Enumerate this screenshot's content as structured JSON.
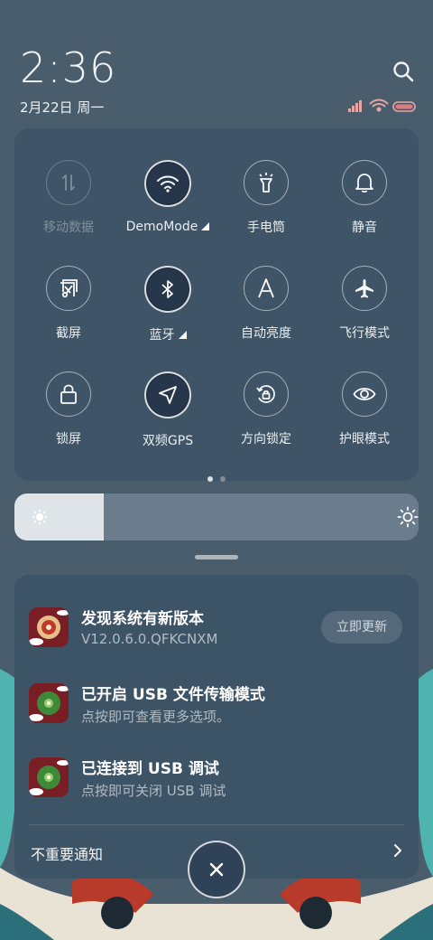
{
  "status_bar": {
    "time": "2:36",
    "date": "2月22日 周一"
  },
  "quick_settings": {
    "tiles": [
      {
        "label": "移动数据",
        "icon": "mobile-data-icon",
        "state": "disabled"
      },
      {
        "label": "DemoMode",
        "icon": "wifi-icon",
        "state": "active",
        "expandable": true
      },
      {
        "label": "手电筒",
        "icon": "flashlight-icon",
        "state": "off"
      },
      {
        "label": "静音",
        "icon": "bell-icon",
        "state": "off"
      },
      {
        "label": "截屏",
        "icon": "screenshot-icon",
        "state": "off"
      },
      {
        "label": "蓝牙",
        "icon": "bluetooth-icon",
        "state": "active",
        "expandable": true
      },
      {
        "label": "自动亮度",
        "icon": "auto-brightness-icon",
        "state": "off"
      },
      {
        "label": "飞行模式",
        "icon": "airplane-icon",
        "state": "off"
      },
      {
        "label": "锁屏",
        "icon": "lock-icon",
        "state": "off"
      },
      {
        "label": "双频GPS",
        "icon": "gps-icon",
        "state": "active"
      },
      {
        "label": "方向锁定",
        "icon": "rotation-lock-icon",
        "state": "off"
      },
      {
        "label": "护眼模式",
        "icon": "eye-icon",
        "state": "off"
      }
    ],
    "page_count": 2,
    "current_page": 1
  },
  "brightness": {
    "level": 0.22
  },
  "notifications": [
    {
      "title": "发现系统有新版本",
      "subtitle": "V12.0.6.0.QFKCNXM",
      "action": "立即更新"
    },
    {
      "title": "已开启 USB 文件传输模式",
      "subtitle": "点按即可查看更多选项。"
    },
    {
      "title": "已连接到 USB 调试",
      "subtitle": "点按即可关闭 USB 调试"
    }
  ],
  "unimportant_notifications": "不重要通知",
  "colors": {
    "panel": "#3f5567",
    "active_tile": "#25364a",
    "background": "#4a5d6c"
  }
}
